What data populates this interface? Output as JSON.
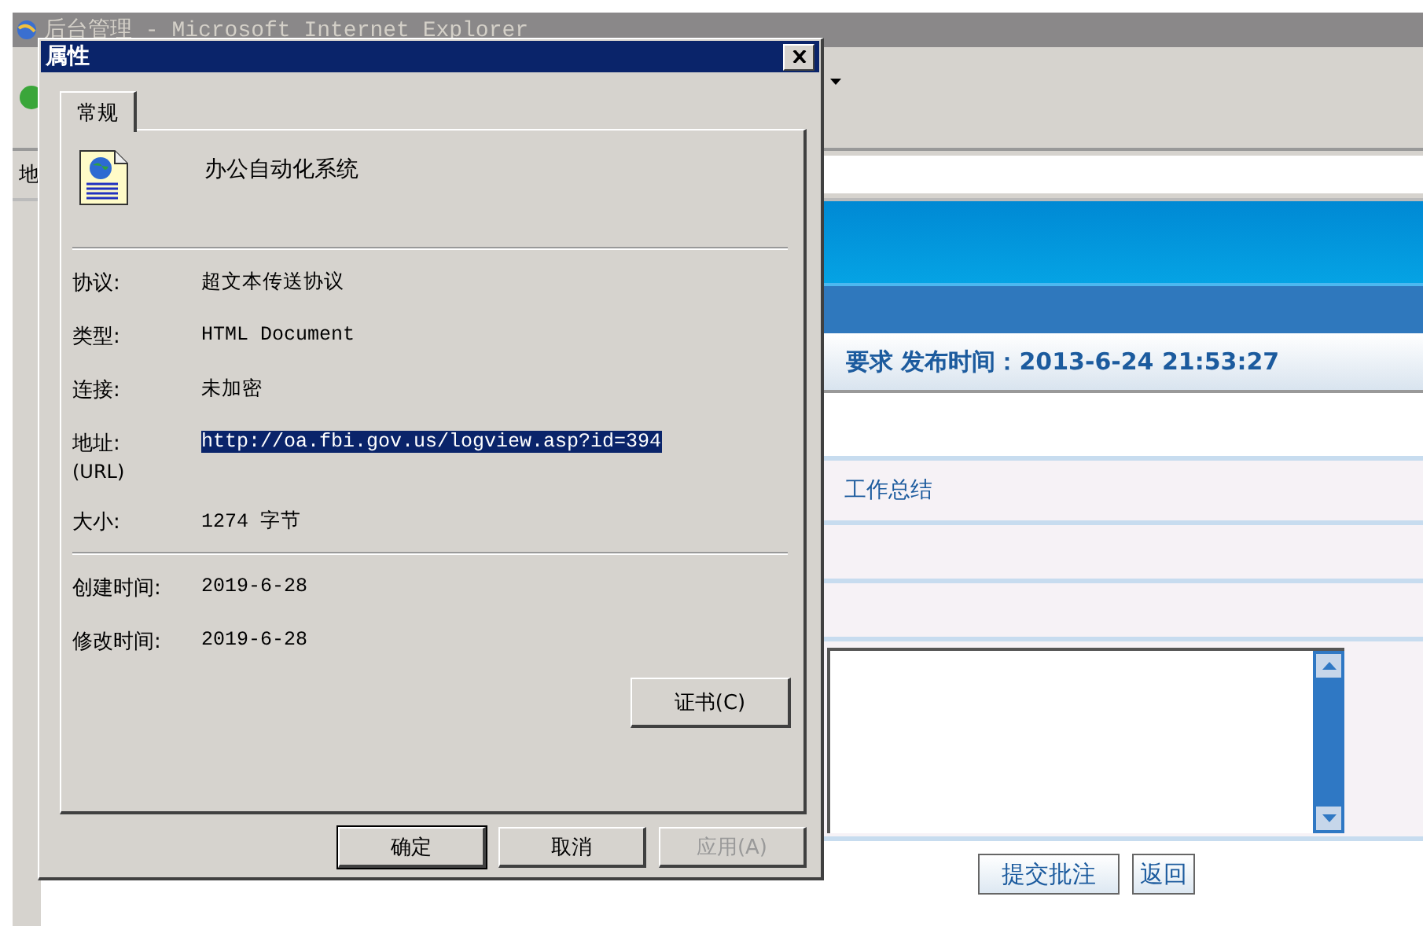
{
  "browser": {
    "title": "后台管理 - Microsoft Internet Explorer",
    "address_label": "地"
  },
  "page": {
    "heading": "要求 发布时间：2013-6-24 21:53:27",
    "item": "工作总结",
    "buttons": [
      {
        "label": "提交批注"
      },
      {
        "label": "返回"
      }
    ]
  },
  "dialog": {
    "title": "属性",
    "tabs": [
      {
        "label": "常规",
        "selected": true
      }
    ],
    "name": "办公自动化系统",
    "groups": [
      [
        {
          "label": "协议:",
          "value": "超文本传送协议",
          "selected": false
        },
        {
          "label": "类型:",
          "value": "HTML Document",
          "selected": false
        },
        {
          "label": "连接:",
          "value": "未加密",
          "selected": false
        },
        {
          "label": "地址:",
          "sublabel": "(URL)",
          "value": "http://oa.fbi.gov.us/logview.asp?id=394",
          "selected": true
        },
        {
          "label": "大小:",
          "value": "1274 字节",
          "selected": false
        }
      ],
      [
        {
          "label": "创建时间:",
          "value": "2019-6-28",
          "selected": false
        },
        {
          "label": "修改时间:",
          "value": "2019-6-28",
          "selected": false
        }
      ]
    ],
    "cert_button": "证书(C)",
    "buttons": [
      {
        "label": "确定",
        "default": true,
        "disabled": false
      },
      {
        "label": "取消",
        "default": false,
        "disabled": false
      },
      {
        "label": "应用(A)",
        "default": false,
        "disabled": true
      }
    ]
  }
}
